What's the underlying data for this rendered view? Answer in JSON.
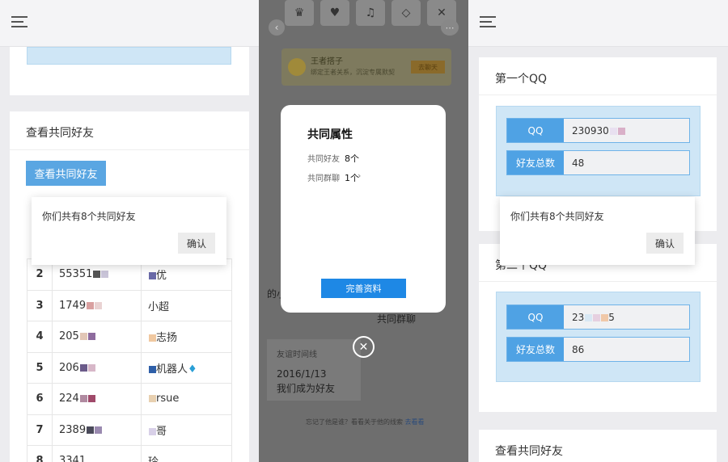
{
  "left": {
    "section_title": "查看共同好友",
    "view_button": "查看共同好友",
    "dialog": {
      "message": "你们共有8个共同好友",
      "ok": "确认"
    },
    "rows": [
      {
        "n": "2",
        "qq": "55351",
        "name": "优"
      },
      {
        "n": "3",
        "qq": "1749",
        "name": "小超"
      },
      {
        "n": "4",
        "qq": "205",
        "name": "志扬"
      },
      {
        "n": "5",
        "qq": "206",
        "name": "机器人"
      },
      {
        "n": "6",
        "qq": "224",
        "name": "rsue"
      },
      {
        "n": "7",
        "qq": "2389",
        "name": "哥"
      },
      {
        "n": "8",
        "qq": "3341",
        "name": "玲"
      }
    ]
  },
  "middle": {
    "banner_title": "王者搭子",
    "banner_sub": "绑定王者关系，沉淀专属默契",
    "banner_btn": "去聊天",
    "modal": {
      "title": "共同属性",
      "friends_label": "共同好友",
      "friends_value": "8个",
      "groups_label": "共同群聊",
      "groups_value": "1个",
      "button": "完善资料"
    },
    "bg_name": "的小叙",
    "bg_group": "共同群聊",
    "timeline_label": "友谊时间线",
    "timeline_date": "2016/1/13",
    "timeline_text": "我们成为好友",
    "footer_text": "忘记了他是谁？看看关于他的线索",
    "footer_link": "去看看"
  },
  "right": {
    "first_title": "第一个QQ",
    "first_qq_label": "QQ",
    "first_qq_value": "230930",
    "first_total_label": "好友总数",
    "first_total_value": "48",
    "second_title": "第二个QQ",
    "second_qq_label": "QQ",
    "second_qq_value": "23",
    "second_qq_suffix": "5",
    "second_total_label": "好友总数",
    "second_total_value": "86",
    "dialog": {
      "message": "你们共有8个共同好友",
      "ok": "确认"
    },
    "bottom_title": "查看共同好友"
  },
  "colors": {
    "accent": "#4fa2e4",
    "button": "#5aa6e2",
    "modal_button": "#1e88e5",
    "light_blue": "#cfe6f6"
  }
}
